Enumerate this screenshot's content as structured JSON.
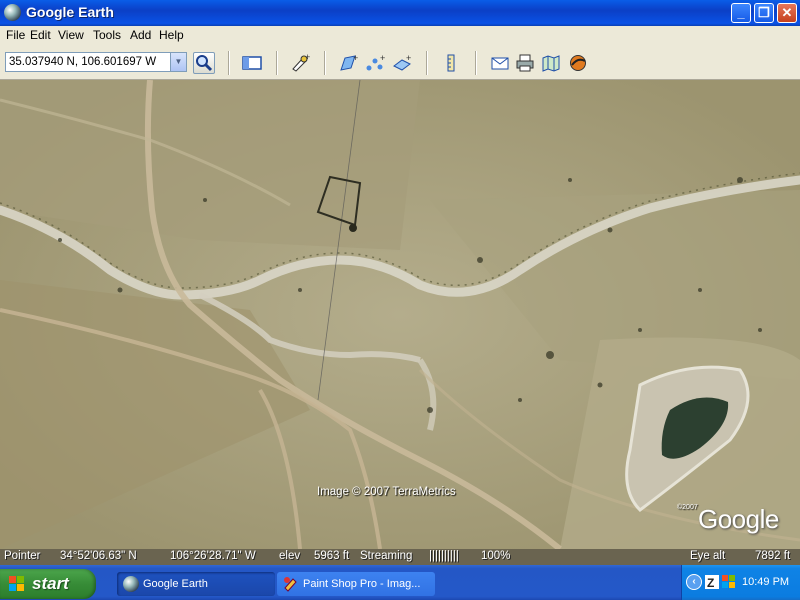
{
  "window": {
    "title": "Google Earth",
    "minimize_label": "_",
    "maximize_label": "❐",
    "close_label": "✕"
  },
  "menu": [
    "File",
    "Edit",
    "View",
    "Tools",
    "Add",
    "Help"
  ],
  "toolbar": {
    "coordinates_value": "35.037940 N, 106.601697 W",
    "icons": [
      "search-icon",
      "sidebar-icon",
      "placemark-icon",
      "polygon-icon",
      "path-icon",
      "overlay-icon",
      "ruler-icon",
      "email-icon",
      "print-icon",
      "maps-icon",
      "sky-icon"
    ]
  },
  "map": {
    "credit": "Image © 2007 TerraMetrics",
    "brand": "Google",
    "brand_year": "©2007"
  },
  "status": {
    "pointer_label": "Pointer",
    "pointer_lat": "34°52'06.63\" N",
    "pointer_lon": "106°26'28.71\" W",
    "elev_label": "elev",
    "elev_value": "5963 ft",
    "streaming_label": "Streaming",
    "streaming_bar": "||||||||||",
    "streaming_percent": "100%",
    "eye_alt_label": "Eye alt",
    "eye_alt_value": "7892 ft"
  },
  "taskbar": {
    "start_label": "start",
    "tasks": [
      {
        "label": "Google Earth",
        "active": true
      },
      {
        "label": "Paint Shop Pro - Imag..."
      }
    ],
    "clock": "10:49 PM"
  },
  "colors": {
    "titlebar": "#0b3fc6",
    "taskbar": "#2457c6",
    "start": "#378c37",
    "terrain": "#a8a080"
  }
}
